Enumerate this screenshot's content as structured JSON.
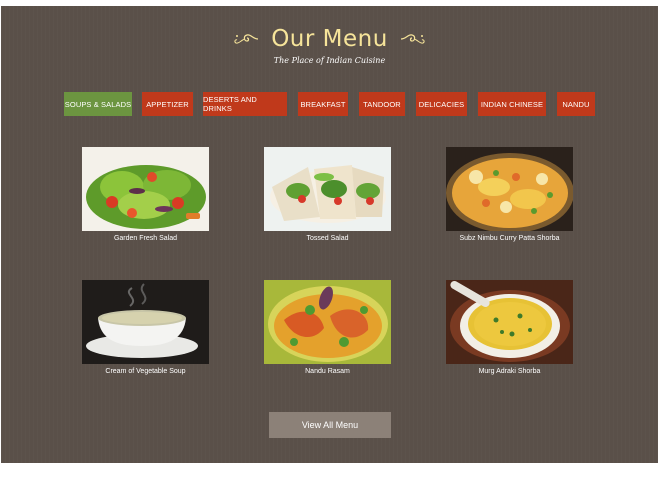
{
  "header": {
    "title": "Our Menu",
    "subtitle": "The Place of Indian Cuisine"
  },
  "tabs": [
    {
      "label": "Soups & Salads",
      "active": true
    },
    {
      "label": "Appetizer",
      "active": false
    },
    {
      "label": "Deserts and Drinks",
      "active": false
    },
    {
      "label": "Breakfast",
      "active": false
    },
    {
      "label": "Tandoor",
      "active": false
    },
    {
      "label": "Delicacies",
      "active": false
    },
    {
      "label": "Indian Chinese",
      "active": false
    },
    {
      "label": "Nandu",
      "active": false
    }
  ],
  "menu_items": [
    {
      "name": "Garden Fresh Salad"
    },
    {
      "name": "Tossed Salad"
    },
    {
      "name": "Subz Nimbu Curry Patta Shorba"
    },
    {
      "name": "Cream of Vegetable Soup"
    },
    {
      "name": "Nandu Rasam"
    },
    {
      "name": "Murg Adraki Shorba"
    }
  ],
  "footer": {
    "view_all_label": "View All Menu"
  },
  "colors": {
    "background": "#5a5049",
    "title": "#f6e49a",
    "tab": "#c0391b",
    "tab_active": "#6c9540",
    "button": "#8c8178"
  }
}
